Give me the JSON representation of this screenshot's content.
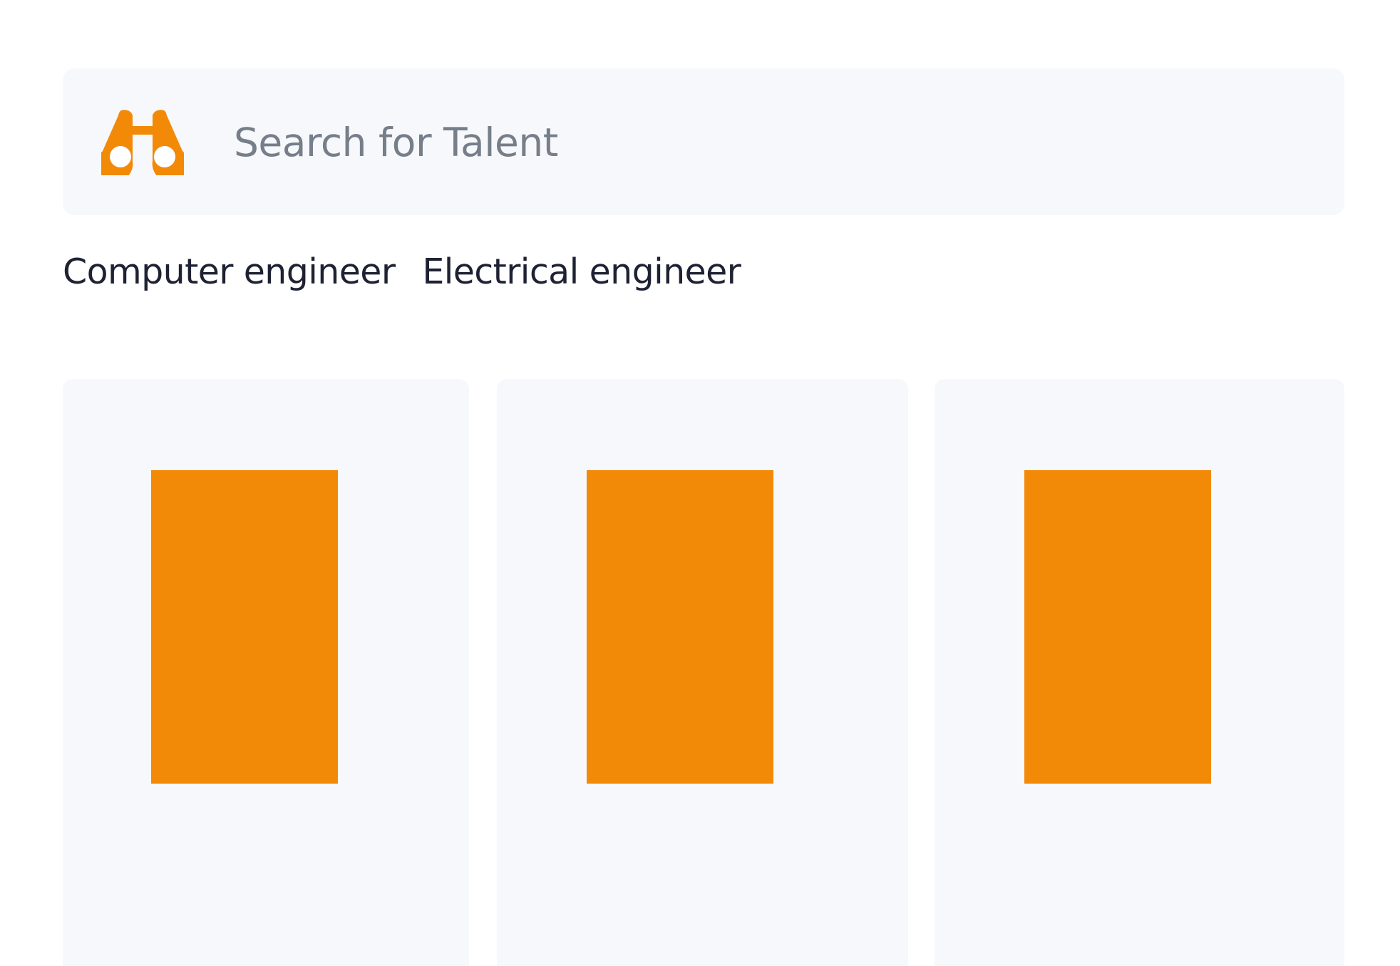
{
  "search": {
    "placeholder": "Search for Talent",
    "icon": "binoculars-icon"
  },
  "tags": [
    {
      "label": "Computer engineer"
    },
    {
      "label": "Electrical engineer"
    }
  ],
  "cards": [
    {
      "image": "profile-image-placeholder"
    },
    {
      "image": "profile-image-placeholder"
    },
    {
      "image": "profile-image-placeholder"
    }
  ],
  "colors": {
    "accent": "#f28a08",
    "panel_background": "#f7f8fb",
    "placeholder_text": "#767e89",
    "tag_text": "#1e2233",
    "page_background": "#ffffff"
  }
}
